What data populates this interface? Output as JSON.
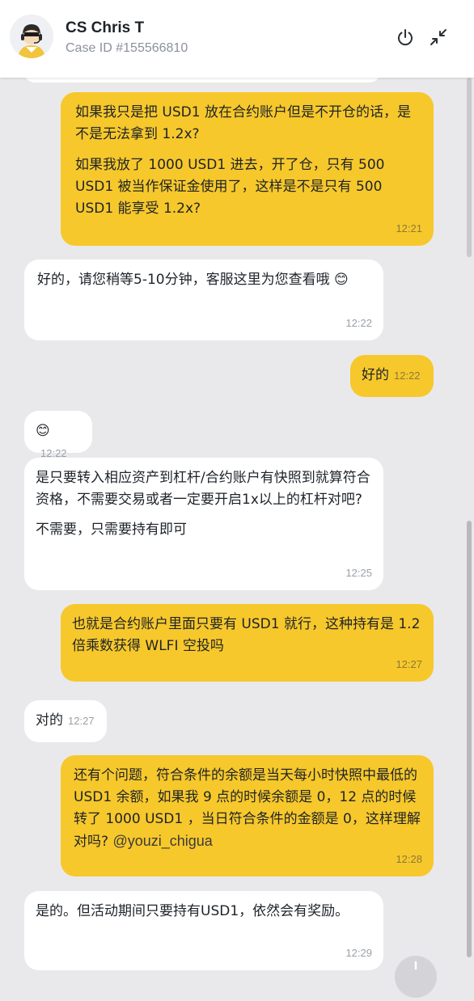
{
  "header": {
    "agent_name": "CS Chris T",
    "case_id": "Case ID #155566810",
    "power_icon": "power-icon",
    "minimize_icon": "minimize-arrows-icon"
  },
  "colors": {
    "me_bubble": "#f7c82b",
    "them_bubble": "#ffffff",
    "background": "#e9e9ec"
  },
  "messages": [
    {
      "sender": "me",
      "paragraphs": [
        "如果我只是把 USD1 放在合约账户但是不开仓的话，是不是无法拿到 1.2x?",
        "如果我放了 1000 USD1 进去，开了仓，只有 500 USD1 被当作保证金使用了，这样是不是只有 500 USD1 能享受 1.2x?"
      ],
      "time": "12:21"
    },
    {
      "sender": "them",
      "paragraphs": [
        "好的，请您稍等5-10分钟，客服这里为您查看哦 😊"
      ],
      "time": "12:22"
    },
    {
      "sender": "me",
      "paragraphs": [
        "好的"
      ],
      "time": "12:22"
    },
    {
      "sender": "them",
      "paragraphs": [
        "😊"
      ],
      "time": "12:22"
    },
    {
      "sender": "them",
      "paragraphs": [
        "是只要转入相应资产到杠杆/合约账户有快照到就算符合资格，不需要交易或者一定要开启1x以上的杠杆对吧?",
        "不需要，只需要持有即可"
      ],
      "time": "12:25"
    },
    {
      "sender": "me",
      "paragraphs": [
        "也就是合约账户里面只要有 USD1 就行，这种持有是 1.2 倍乘数获得 WLFI 空投吗"
      ],
      "time": "12:27"
    },
    {
      "sender": "them",
      "paragraphs": [
        "对的"
      ],
      "time": "12:27"
    },
    {
      "sender": "me",
      "paragraphs": [
        "还有个问题，符合条件的余额是当天每小时快照中最低的 USD1 余额，如果我 9 点的时候余额是 0，12 点的时候转了 1000 USD1 ，当日符合条件的金额是 0，这样理解对吗?"
      ],
      "watermark": "@youzi_chigua",
      "time": "12:28"
    },
    {
      "sender": "them",
      "paragraphs": [
        "是的。但活动期间只要持有USD1，依然会有奖励。"
      ],
      "time": "12:29"
    }
  ]
}
